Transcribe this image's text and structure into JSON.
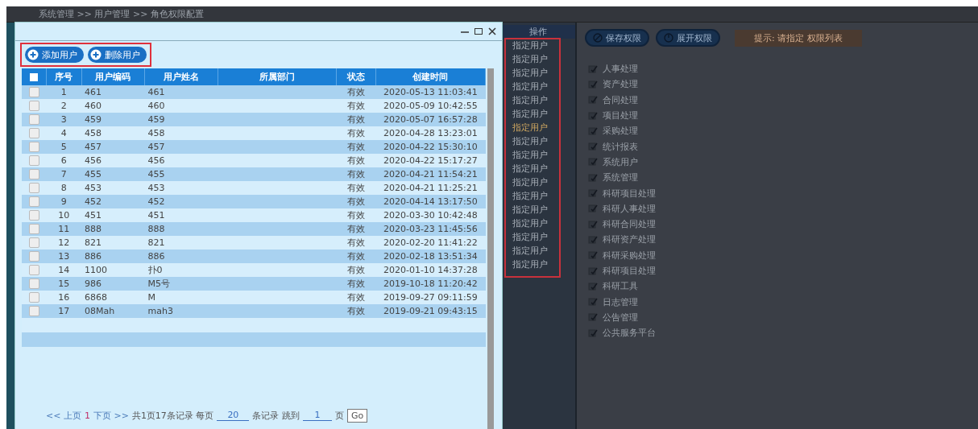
{
  "breadcrumb": "系统管理 >> 用户管理 >> 角色权限配置",
  "dialog": {
    "toolbar": [
      {
        "label": "添加用户",
        "kind": "add"
      },
      {
        "label": "删除用户",
        "kind": "add"
      }
    ],
    "table": {
      "all_checked": false,
      "columns": [
        "序号",
        "用户编码",
        "用户姓名",
        "所属部门",
        "状态",
        "创建时间"
      ],
      "rows": [
        {
          "no": "1",
          "code": "461",
          "name": "461",
          "status": "有效",
          "created": "2020-05-13 11:03:41",
          "checked": false
        },
        {
          "no": "2",
          "code": "460",
          "name": "460",
          "status": "有效",
          "created": "2020-05-09 10:42:55",
          "checked": false
        },
        {
          "no": "3",
          "code": "459",
          "name": "459",
          "status": "有效",
          "created": "2020-05-07 16:57:28",
          "checked": false
        },
        {
          "no": "4",
          "code": "458",
          "name": "458",
          "status": "有效",
          "created": "2020-04-28 13:23:01",
          "checked": false
        },
        {
          "no": "5",
          "code": "457",
          "name": "457",
          "status": "有效",
          "created": "2020-04-22 15:30:10",
          "checked": false
        },
        {
          "no": "6",
          "code": "456",
          "name": "456",
          "status": "有效",
          "created": "2020-04-22 15:17:27",
          "checked": false
        },
        {
          "no": "7",
          "code": "455",
          "name": "455",
          "status": "有效",
          "created": "2020-04-21 11:54:21",
          "checked": false
        },
        {
          "no": "8",
          "code": "453",
          "name": "453",
          "status": "有效",
          "created": "2020-04-21 11:25:21",
          "checked": false
        },
        {
          "no": "9",
          "code": "452",
          "name": "452",
          "status": "有效",
          "created": "2020-04-14 13:17:50",
          "checked": false
        },
        {
          "no": "10",
          "code": "451",
          "name": "451",
          "status": "有效",
          "created": "2020-03-30 10:42:48",
          "checked": false
        },
        {
          "no": "11",
          "code": "888",
          "name": "888",
          "status": "有效",
          "created": "2020-03-23 11:45:56",
          "checked": false
        },
        {
          "no": "12",
          "code": "821",
          "name": "821",
          "status": "有效",
          "created": "2020-02-20 11:41:22",
          "checked": false
        },
        {
          "no": "13",
          "code": "886",
          "name": "886",
          "status": "有效",
          "created": "2020-02-18 13:51:34",
          "checked": false
        },
        {
          "no": "14",
          "code": "1100",
          "name": "扑0",
          "status": "有效",
          "created": "2020-01-10 14:37:28",
          "checked": false
        },
        {
          "no": "15",
          "code": "986",
          "name": "M5号",
          "status": "有效",
          "created": "2019-10-18 11:20:42",
          "checked": false
        },
        {
          "no": "16",
          "code": "6868",
          "name": "M",
          "status": "有效",
          "created": "2019-09-27 09:11:59",
          "checked": false
        },
        {
          "no": "17",
          "code": "08Mah",
          "name": "mah3",
          "status": "有效",
          "created": "2019-09-21 09:43:15",
          "checked": false
        }
      ]
    },
    "pager": {
      "prev": "<< 上页",
      "current": "1",
      "next": "下页 >>",
      "summary": "共1页17条记录 每页",
      "page_size": "20",
      "per_page_suffix": "条记录 跳到",
      "jump_to": "1",
      "page_suffix": "页",
      "go": "Go"
    }
  },
  "background": {
    "column_header": "操作",
    "row_action": [
      "指定用户",
      "指定用户",
      "指定用户",
      "指定用户",
      "指定用户",
      "指定用户",
      "指定用户",
      "指定用户",
      "指定用户",
      "指定用户",
      "指定用户",
      "指定用户",
      "指定用户",
      "指定用户",
      "指定用户",
      "指定用户",
      "指定用户"
    ],
    "buttons": [
      "保存权限",
      "展开权限"
    ],
    "hint": "提示: 请指定 权限列表",
    "permissions": [
      "人事处理",
      "资产处理",
      "合同处理",
      "项目处理",
      "采购处理",
      "统计报表",
      "系统用户",
      "系统管理",
      "科研项目处理",
      "科研人事处理",
      "科研合同处理",
      "科研资产处理",
      "科研采购处理",
      "科研项目处理",
      "科研工具",
      "日志管理",
      "公告管理",
      "公共服务平台"
    ]
  }
}
